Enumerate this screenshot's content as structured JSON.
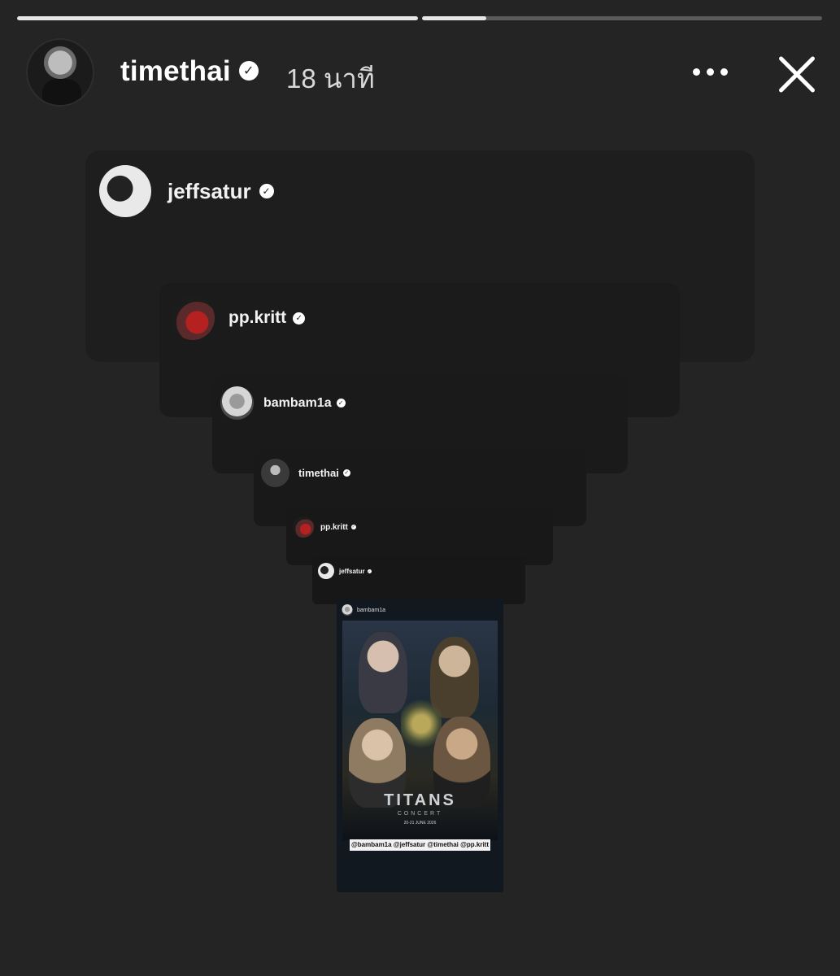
{
  "progress": {
    "segments": [
      {
        "fill": 1.0
      },
      {
        "fill": 0.16
      }
    ]
  },
  "header": {
    "username": "timethai",
    "time": "18 นาที",
    "verified_icon": "verified-badge-icon",
    "more_icon": "more-icon",
    "close_icon": "close-icon"
  },
  "shares": [
    {
      "username": "jeffsatur"
    },
    {
      "username": "pp.kritt"
    },
    {
      "username": "bambam1a"
    },
    {
      "username": "timethai"
    },
    {
      "username": "pp.kritt"
    },
    {
      "username": "jeffsatur"
    }
  ],
  "poster": {
    "username": "bambam1a",
    "title": "TITANS",
    "subtitle": "CONCERT",
    "date": "20-21 JUNE 2026",
    "mentions": "@bambam1a @jeffsatur @timethai @pp.kritt"
  }
}
